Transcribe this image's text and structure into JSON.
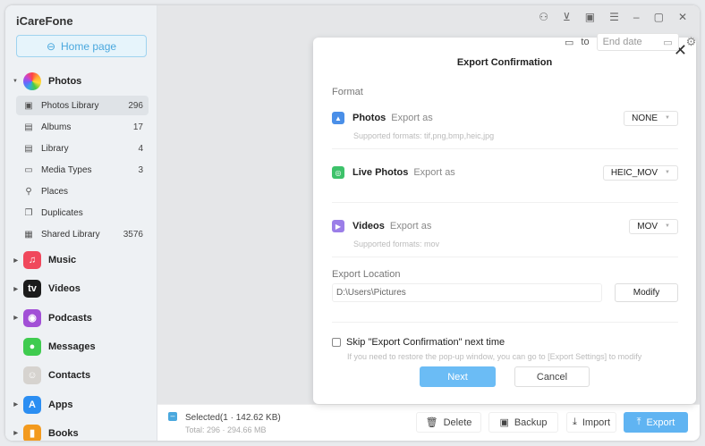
{
  "app": {
    "title": "iCareFone",
    "home_label": "Home page"
  },
  "sidebar": {
    "photos": {
      "label": "Photos",
      "items": [
        {
          "label": "Photos Library",
          "count": "296",
          "icon": "image-icon"
        },
        {
          "label": "Albums",
          "count": "17",
          "icon": "album-icon"
        },
        {
          "label": "Library",
          "count": "4",
          "icon": "library-icon"
        },
        {
          "label": "Media Types",
          "count": "3",
          "icon": "video-camera-icon"
        },
        {
          "label": "Places",
          "count": "",
          "icon": "pin-icon"
        },
        {
          "label": "Duplicates",
          "count": "",
          "icon": "duplicates-icon"
        },
        {
          "label": "Shared Library",
          "count": "3576",
          "icon": "shared-icon"
        }
      ]
    },
    "categories": [
      {
        "label": "Music",
        "color": "#f0485c",
        "glyph": "♫",
        "arrow": true
      },
      {
        "label": "Videos",
        "color": "#1c1c1c",
        "glyph": "tv",
        "arrow": true
      },
      {
        "label": "Podcasts",
        "color": "#a24fd6",
        "glyph": "◉",
        "arrow": true
      },
      {
        "label": "Messages",
        "color": "#3fcb4f",
        "glyph": "●",
        "arrow": false
      },
      {
        "label": "Contacts",
        "color": "#d6d3cf",
        "glyph": "☺",
        "arrow": false
      },
      {
        "label": "Apps",
        "color": "#2b8ef2",
        "glyph": "A",
        "arrow": true
      },
      {
        "label": "Books",
        "color": "#f39a1e",
        "glyph": "▮",
        "arrow": true
      }
    ]
  },
  "toolbar": {
    "to_label": "to",
    "end_date_placeholder": "End date"
  },
  "dialog": {
    "title": "Export Confirmation",
    "format_label": "Format",
    "export_as": "Export as",
    "photos": {
      "label": "Photos",
      "value": "NONE",
      "hint": "Supported formats: tif,png,bmp,heic,jpg",
      "color": "#4a8fe8"
    },
    "live": {
      "label": "Live Photos",
      "value": "HEIC_MOV",
      "color": "#3dc26a"
    },
    "videos": {
      "label": "Videos",
      "value": "MOV",
      "hint": "Supported formats: mov",
      "color": "#9b7ee8"
    },
    "location_label": "Export Location",
    "location_value": "D:\\Users\\Pictures",
    "modify_label": "Modify",
    "skip_label": "Skip \"Export Confirmation\" next time",
    "skip_hint": "If you need to restore the pop-up window, you can go to [Export Settings] to modify",
    "next_label": "Next",
    "cancel_label": "Cancel"
  },
  "bottom": {
    "selected": "Selected(1 · 142.62 KB)",
    "total": "Total: 296 · 294.66 MB",
    "delete": "Delete",
    "backup": "Backup",
    "import": "Import",
    "export": "Export"
  }
}
